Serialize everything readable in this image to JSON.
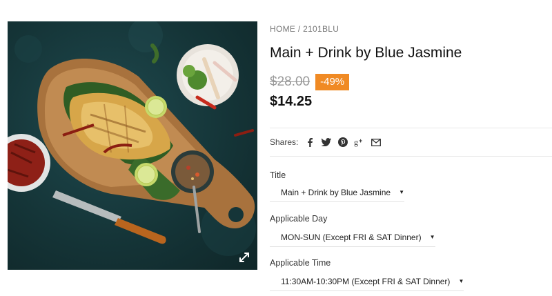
{
  "breadcrumb": {
    "home": "HOME",
    "separator": " / ",
    "current": "2101BLU"
  },
  "product": {
    "title": "Main + Drink by Blue Jasmine",
    "old_price": "$28.00",
    "discount": "-49%",
    "price": "$14.25"
  },
  "shares": {
    "label": "Shares:",
    "icons": [
      "facebook-icon",
      "twitter-icon",
      "pinterest-icon",
      "google-plus-icon",
      "email-icon"
    ]
  },
  "options": {
    "title": {
      "label": "Title",
      "value": "Main + Drink by Blue Jasmine"
    },
    "day": {
      "label": "Applicable Day",
      "value": "MON-SUN (Except FRI & SAT Dinner)"
    },
    "time": {
      "label": "Applicable Time",
      "value": "11:30AM-10:30PM (Except FRI & SAT Dinner)"
    }
  },
  "colors": {
    "badge": "#f08a24",
    "image_background": "#153538"
  }
}
